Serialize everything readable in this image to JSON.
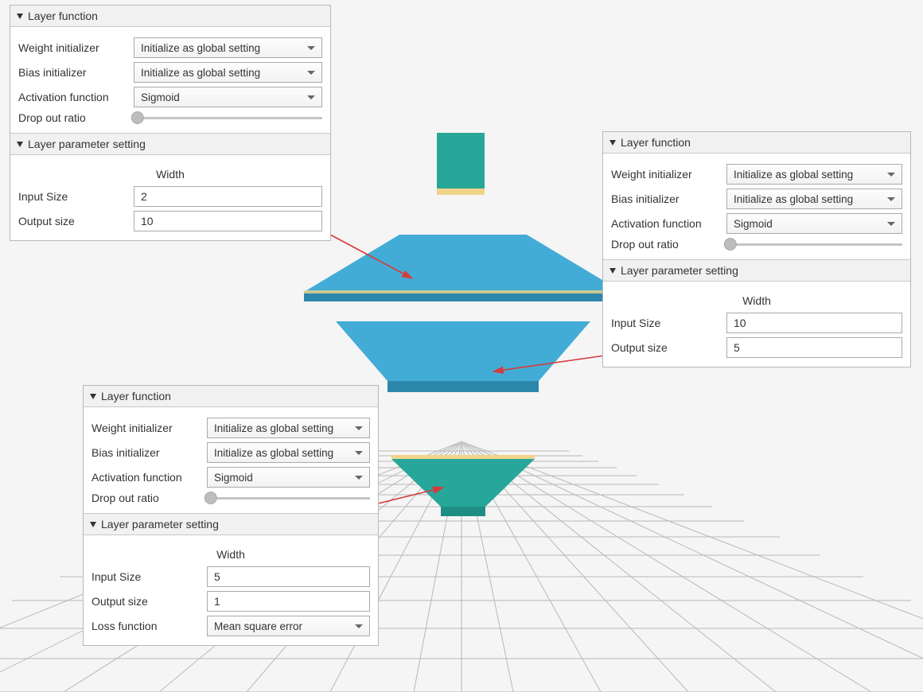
{
  "headers": {
    "layer_function": "Layer function",
    "layer_param_setting": "Layer parameter setting",
    "width": "Width"
  },
  "labels": {
    "weight_init": "Weight initializer",
    "bias_init": "Bias initializer",
    "activation": "Activation function",
    "dropout": "Drop out ratio",
    "input_size": "Input Size",
    "output_size": "Output size",
    "loss_fn": "Loss function"
  },
  "panel1": {
    "weight_init": "Initialize as global setting",
    "bias_init": "Initialize as global setting",
    "activation": "Sigmoid",
    "input_size": "2",
    "output_size": "10"
  },
  "panel2": {
    "weight_init": "Initialize as global setting",
    "bias_init": "Initialize as global setting",
    "activation": "Sigmoid",
    "input_size": "10",
    "output_size": "5"
  },
  "panel3": {
    "weight_init": "Initialize as global setting",
    "bias_init": "Initialize as global setting",
    "activation": "Sigmoid",
    "input_size": "5",
    "output_size": "1",
    "loss_fn": "Mean square error"
  },
  "colors": {
    "teal": "#27a69a",
    "teal_dark": "#1e8e84",
    "blue": "#43acd6",
    "blue_dark": "#2b87ab",
    "sand": "#f0d48a",
    "arrow": "#d63a3a"
  }
}
